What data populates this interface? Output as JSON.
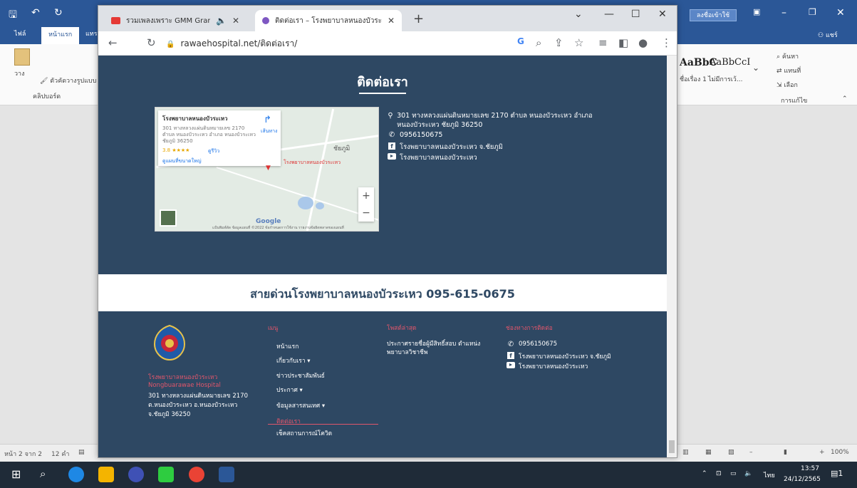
{
  "word": {
    "tabs": [
      "ไฟล์",
      "หน้าแรก",
      "แทร"
    ],
    "search_button": "ลงชื่อเข้าใช้",
    "share": "แชร์",
    "ribbon": {
      "paste": "วาง",
      "format_painter": "ตัวคัดวางรูปแบบ",
      "clipboard": "คลิปบอร์ด",
      "style1": "AaBbC",
      "style1_name": "ชื่อเรื่อง 1",
      "style2": "AaBbCcI",
      "style2_name": "ไม่มีการเว้...",
      "find": "ค้นหา",
      "replace": "แทนที่",
      "select": "เลือก",
      "editing": "การแก้ไข"
    },
    "status": {
      "page": "หน้า 2 จาก 2",
      "words": "12 คำ",
      "zoom": "100%"
    }
  },
  "browser": {
    "tabs": [
      {
        "title": "รวมเพลงเพราะ GMM Grammy",
        "favicon_color": "#e53935"
      },
      {
        "title": "ติดต่อเรา – โรงพยาบาลหนองบัวระเหว",
        "favicon_color": "#7e57c2"
      }
    ],
    "new_tab": "+",
    "url": "rawaehospital.net/ติดต่อเรา/",
    "google_letter": "G"
  },
  "contact": {
    "title": "ติดต่อเรา",
    "address": "301 ทางหลวงแผ่นดินหมายเลข 2170 ตำบล หนองบัวระเหว อำเภอ หนองบัวระเหว ชัยภูมิ 36250",
    "phone": "0956150675",
    "facebook": "โรงพยาบาลหนองบัวระเหว จ.ชัยภูมิ",
    "youtube": "โรงพยาบาลหนองบัวระเหว"
  },
  "map": {
    "card_title": "โรงพยาบาลหนองบัวระเหว",
    "card_address": "301 ทางหลวงแผ่นดินหมายเลข 2170",
    "card_address2": "ตำบล หนองบัวระเหว อำเภอ หนองบัวระเหว",
    "card_address3": "ชัยภูมิ 36250",
    "rating": "3.8 ★★★★",
    "reviews": "ดูรีวิว",
    "larger": "ดูแผนที่ขนาดใหญ่",
    "directions": "เส้นทาง",
    "place_label": "โรงพยาบาลหนองบัวระเหว",
    "town": "ชัยภูมิ",
    "zoom_in": "+",
    "zoom_out": "−",
    "google": "Google",
    "footer": "แป้นพิมพ์ลัด   ข้อมูลแผนที่ ©2022   ข้อกำหนดการใช้งาน   รายงานข้อผิดพลาดของแผนที่"
  },
  "hotline": "สายด่วนโรงพยาบาลหนองบัวระเหว 095-615-0675",
  "footer": {
    "org_th": "โรงพยาบาลหนองบัวระเหว",
    "org_en": "Nongbuarawae Hospital",
    "org_address": "301 ทางหลวงแผ่นดินหมายเลข 2170 ต.หนองบัวระเหว อ.หนองบัวระเหว จ.ชัยภูมิ 36250",
    "menu_heading": "เมนู",
    "menu": [
      "หน้าแรก",
      "เกี่ยวกับเรา ▾",
      "ข่าวประชาสัมพันธ์",
      "ประกาศ ▾",
      "ข้อมูลสารสนเทศ ▾",
      "ติดต่อเรา",
      "เช็คสถานการณ์โควิด"
    ],
    "news_heading": "โพสต์ล่าสุด",
    "news_item": "ประกาศรายชื่อผู้มีสิทธิ์สอบ ตำแหน่ง พยาบาลวิชาชีพ",
    "contact_heading": "ช่องทางการติดต่อ",
    "phone": "0956150675",
    "facebook": "โรงพยาบาลหนองบัวระเหว จ.ชัยภูมิ",
    "youtube": "โรงพยาบาลหนองบัวระเหว"
  },
  "taskbar": {
    "lang": "ไทย",
    "time": "13:57",
    "date": "24/12/2565",
    "notif": "1"
  }
}
